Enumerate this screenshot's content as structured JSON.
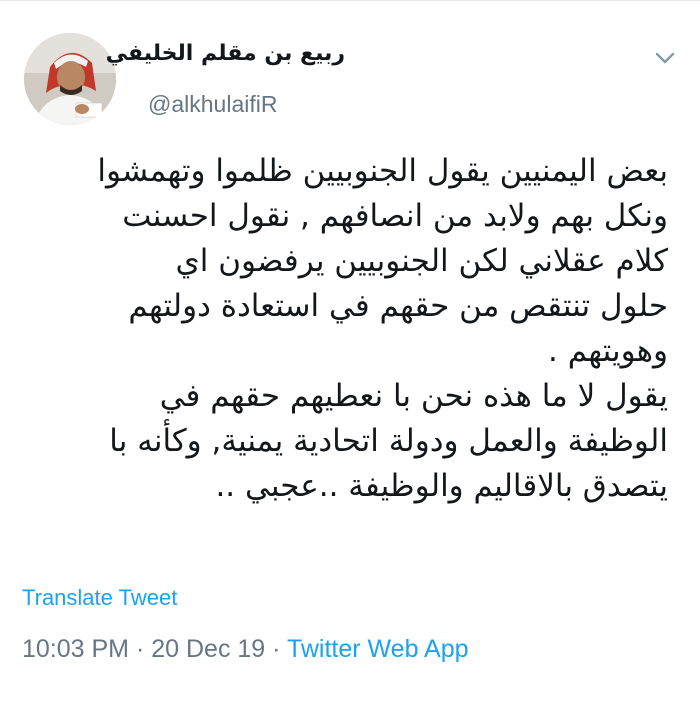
{
  "author": {
    "display_name": "ربيع بن مقلم الخليفي",
    "handle": "@alkhulaifiR",
    "avatar_icon": "profile-photo"
  },
  "tweet": {
    "lines": [
      "بعض اليمنيين يقول الجنوبيين ظلموا وتهمشوا",
      "ونكل بهم ولابد من انصافهم , نقول احسنت",
      "كلام عقلاني لكن الجنوبيين يرفضون اي",
      "حلول تنتقص من حقهم في استعادة دولتهم",
      "وهويتهم .",
      "يقول لا ما هذه نحن با نعطيهم حقهم في",
      "الوظيفة والعمل ودولة اتحادية يمنية, وكأنه با",
      "يتصدق بالاقاليم والوظيفة ..عجبي .."
    ]
  },
  "actions": {
    "translate_label": "Translate Tweet",
    "menu_icon": "chevron-down-icon"
  },
  "meta": {
    "time": "10:03 PM",
    "separator1": " · ",
    "date": "20 Dec 19",
    "separator2": " · ",
    "source": "Twitter Web App"
  },
  "colors": {
    "link": "#1da1f2",
    "secondary_text": "#657786",
    "primary_text": "#14171a"
  }
}
